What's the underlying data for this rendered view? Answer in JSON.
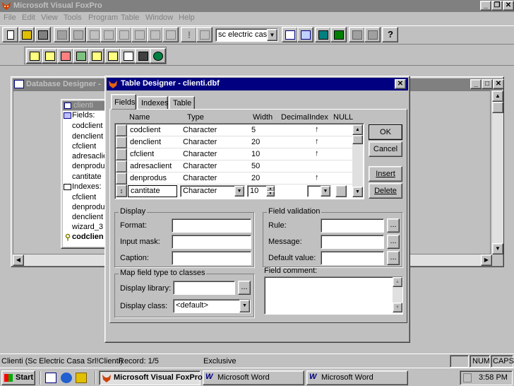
{
  "app": {
    "title": "Microsoft Visual FoxPro",
    "menu": [
      "File",
      "Edit",
      "View",
      "Tools",
      "Program",
      "Table",
      "Window",
      "Help"
    ],
    "toolbar_combo": "sc electric casa"
  },
  "db_designer": {
    "title": "Database Designer - ",
    "table_title": "clienti",
    "fields_header": "Fields:",
    "fields": [
      "codclient",
      "denclient",
      "cfclient",
      "adresaclie",
      "denprodus",
      "cantitate"
    ],
    "indexes_header": "Indexes:",
    "indexes": [
      "cfclient",
      "denprodus",
      "denclient",
      "wizard_3"
    ],
    "primary_index": "codclien"
  },
  "table_designer": {
    "title": "Table Designer - clienti.dbf",
    "tabs": [
      "Fields",
      "Indexes",
      "Table"
    ],
    "columns": [
      "Name",
      "Type",
      "Width",
      "Decimal",
      "Index",
      "NULL"
    ],
    "rows": [
      {
        "name": "codclient",
        "type": "Character",
        "width": "5",
        "index": "↑"
      },
      {
        "name": "denclient",
        "type": "Character",
        "width": "20",
        "index": "↑"
      },
      {
        "name": "cfclient",
        "type": "Character",
        "width": "10",
        "index": "↑"
      },
      {
        "name": "adresaclient",
        "type": "Character",
        "width": "50",
        "index": ""
      },
      {
        "name": "denprodus",
        "type": "Character",
        "width": "20",
        "index": "↑"
      }
    ],
    "edit_row": {
      "name": "cantitate",
      "type": "Character",
      "width": "10"
    },
    "buttons": {
      "ok": "OK",
      "cancel": "Cancel",
      "insert": "Insert",
      "delete": "Delete"
    },
    "display": {
      "group": "Display",
      "format": "Format:",
      "input_mask": "Input mask:",
      "caption": "Caption:"
    },
    "validation": {
      "group": "Field validation",
      "rule": "Rule:",
      "message": "Message:",
      "default": "Default value:"
    },
    "map": {
      "group": "Map field type to classes",
      "library": "Display library:",
      "class": "Display class:",
      "class_value": "<default>"
    },
    "comment": "Field comment:"
  },
  "status": {
    "left": "Clienti (Sc Electric Casa Srl!Clienti)",
    "record": "Record: 1/5",
    "mode": "Exclusive",
    "num": "NUM",
    "caps": "CAPS"
  },
  "taskbar": {
    "start": "Start",
    "tasks": [
      "Microsoft Visual FoxPro",
      "Microsoft Word",
      "Microsoft Word"
    ],
    "clock": "3:58 PM"
  }
}
